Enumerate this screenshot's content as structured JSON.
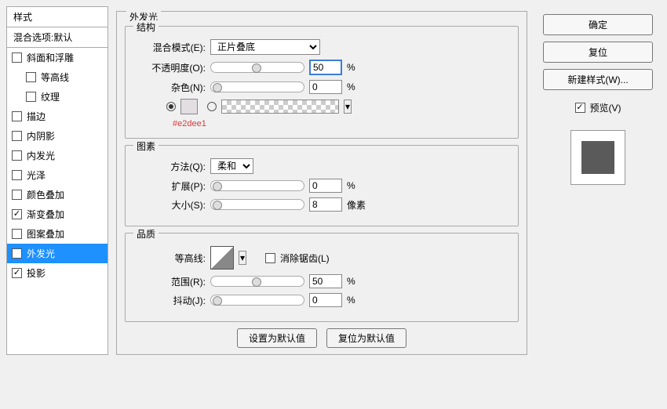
{
  "sidebar": {
    "header": "样式",
    "blending": "混合选项:默认",
    "items": [
      {
        "label": "斜面和浮雕",
        "checked": false
      },
      {
        "label": "等高线",
        "checked": false,
        "sub": true
      },
      {
        "label": "纹理",
        "checked": false,
        "sub": true
      },
      {
        "label": "描边",
        "checked": false
      },
      {
        "label": "内阴影",
        "checked": false
      },
      {
        "label": "内发光",
        "checked": false
      },
      {
        "label": "光泽",
        "checked": false
      },
      {
        "label": "颜色叠加",
        "checked": false
      },
      {
        "label": "渐变叠加",
        "checked": true
      },
      {
        "label": "图案叠加",
        "checked": false
      },
      {
        "label": "外发光",
        "checked": true,
        "selected": true
      },
      {
        "label": "投影",
        "checked": true
      }
    ]
  },
  "main": {
    "title": "外发光",
    "structure": {
      "title": "结构",
      "blend_mode_label": "混合模式(E):",
      "blend_mode_value": "正片叠底",
      "opacity_label": "不透明度(O):",
      "opacity_value": "50",
      "opacity_unit": "%",
      "noise_label": "杂色(N):",
      "noise_value": "0",
      "noise_unit": "%",
      "color_hex": "#e2dee1"
    },
    "elements": {
      "title": "图素",
      "technique_label": "方法(Q):",
      "technique_value": "柔和",
      "spread_label": "扩展(P):",
      "spread_value": "0",
      "spread_unit": "%",
      "size_label": "大小(S):",
      "size_value": "8",
      "size_unit": "像素"
    },
    "quality": {
      "title": "品质",
      "contour_label": "等高线:",
      "antialias_label": "消除锯齿(L)",
      "range_label": "范围(R):",
      "range_value": "50",
      "range_unit": "%",
      "jitter_label": "抖动(J):",
      "jitter_value": "0",
      "jitter_unit": "%"
    },
    "buttons": {
      "default": "设置为默认值",
      "reset": "复位为默认值"
    }
  },
  "right": {
    "ok": "确定",
    "reset": "复位",
    "new_style": "新建样式(W)...",
    "preview": "预览(V)"
  }
}
